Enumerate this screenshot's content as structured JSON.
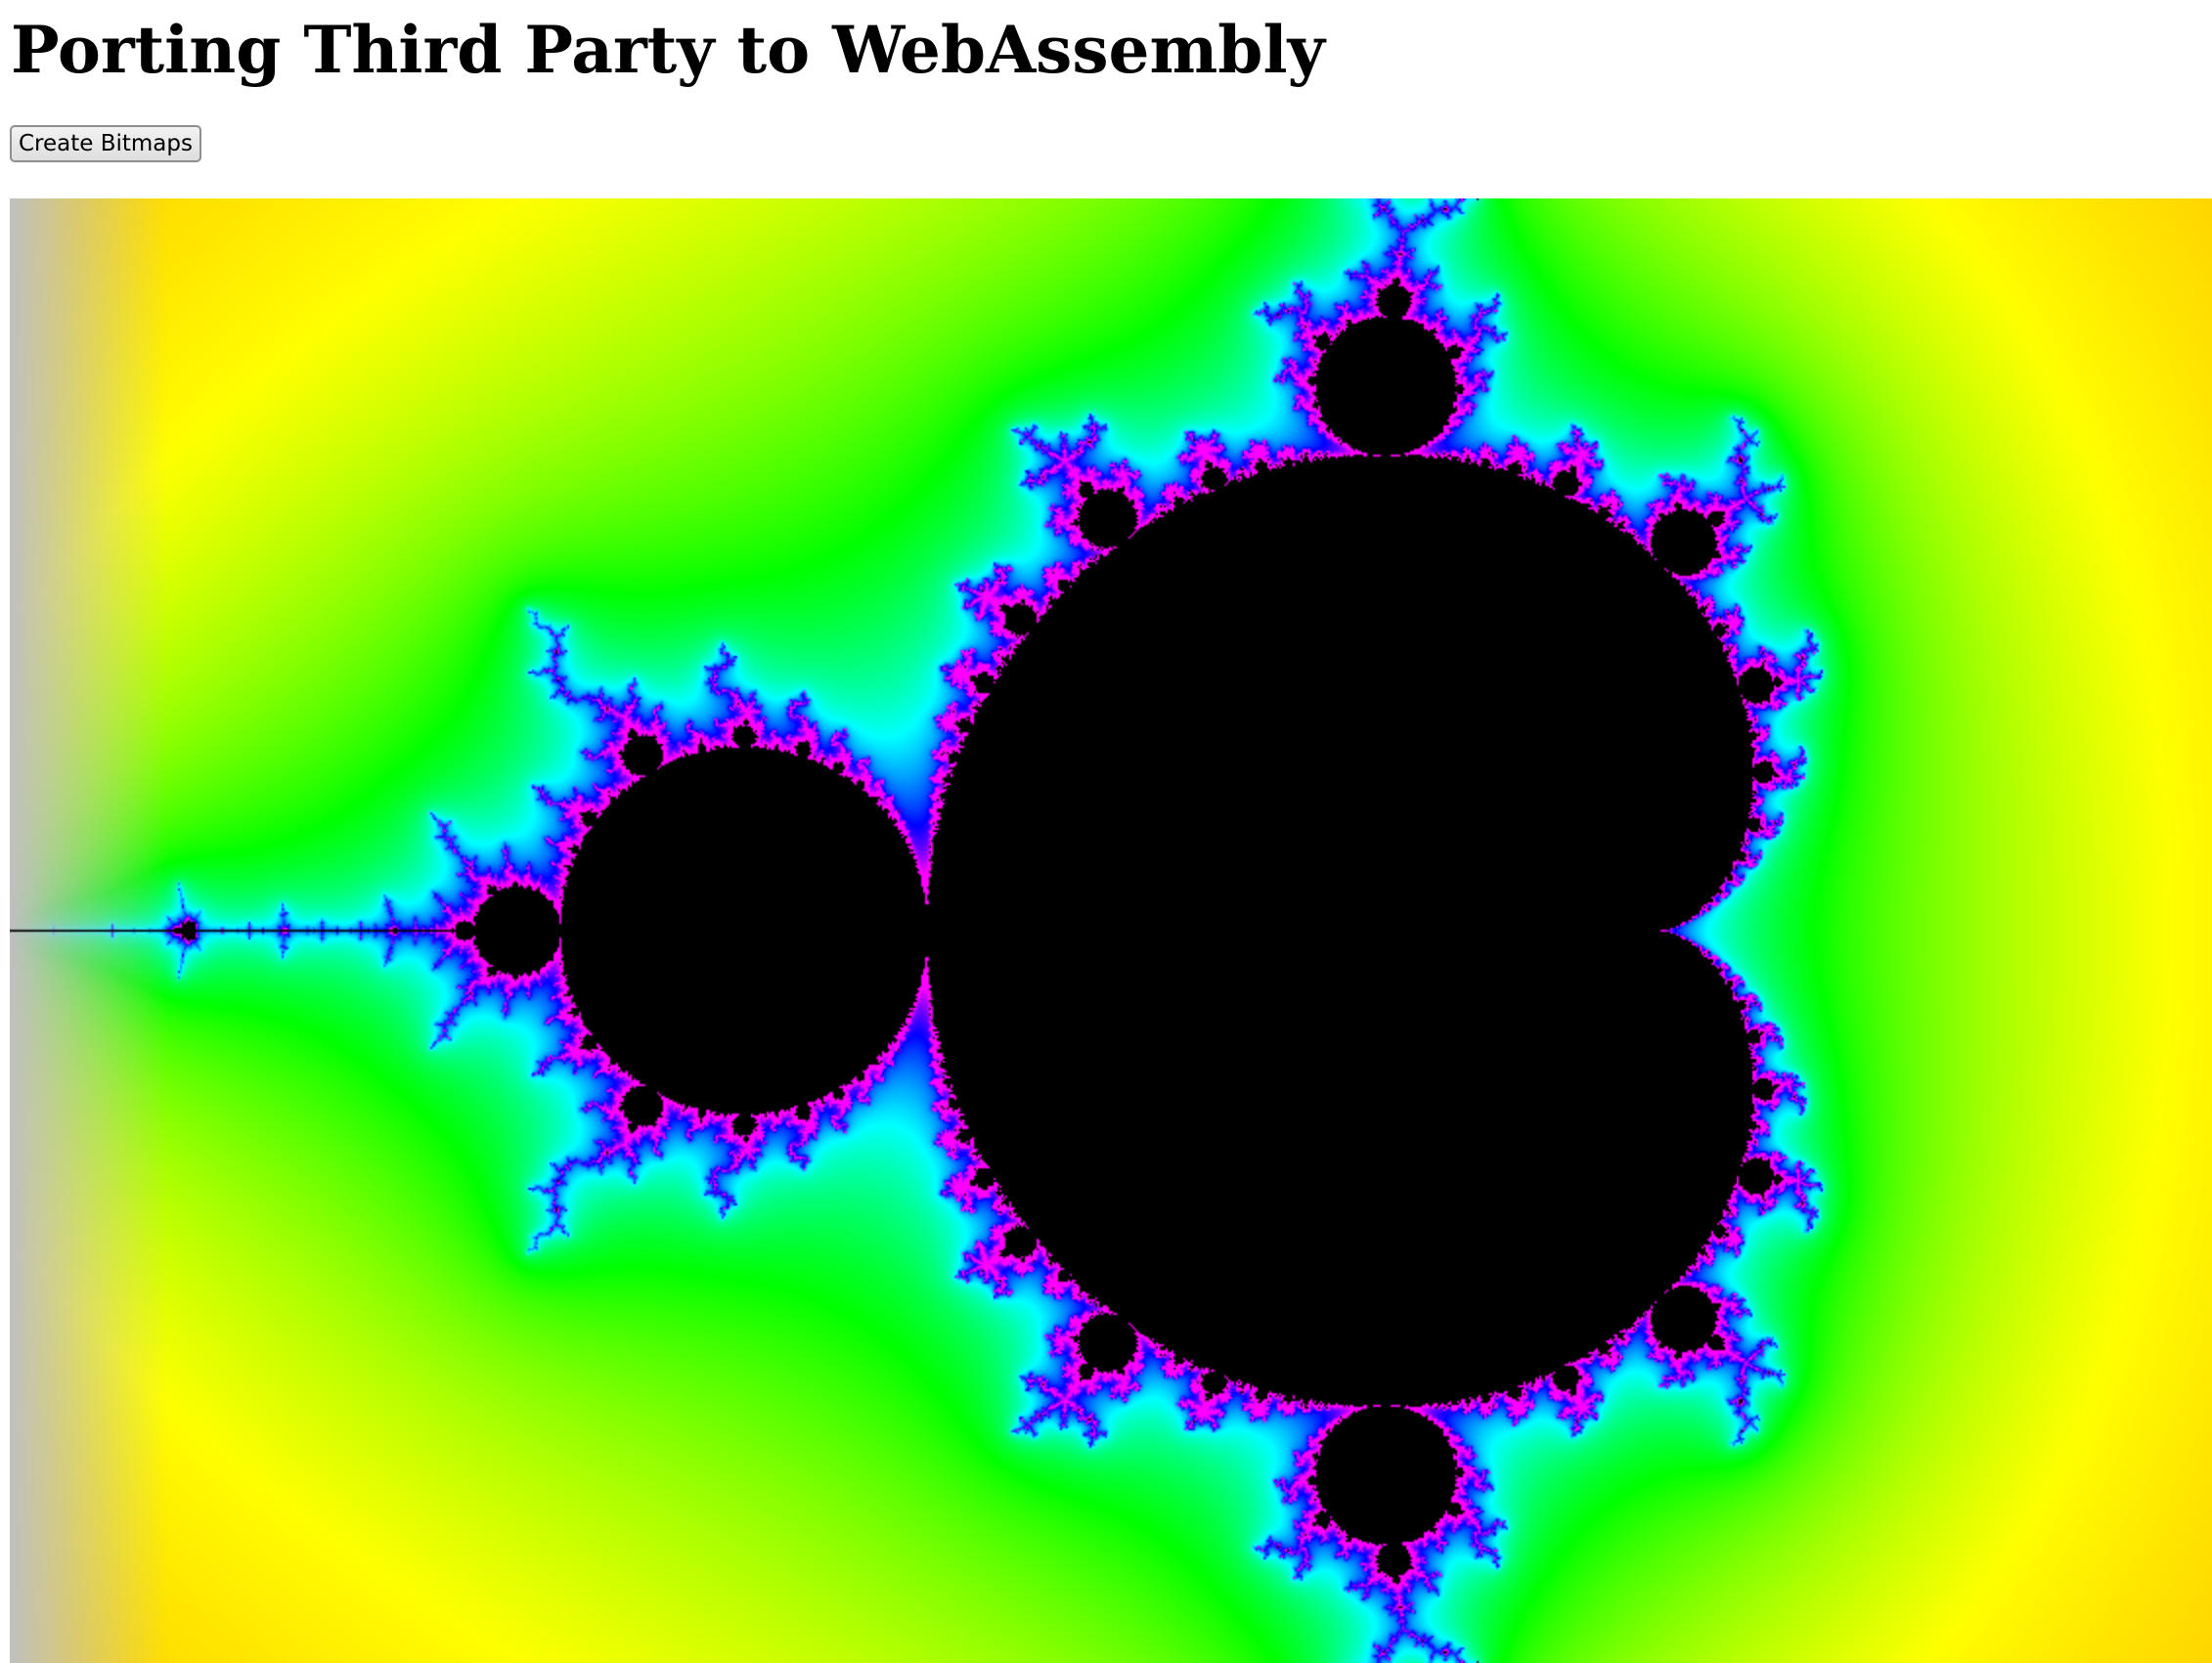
{
  "page": {
    "title": "Porting Third Party to WebAssembly"
  },
  "controls": {
    "create_label": "Create Bitmaps"
  },
  "fractal": {
    "name": "Mandelbrot set",
    "view": {
      "re_min": -2.0,
      "re_max": 1.0,
      "im_min": -1.0,
      "im_max": 1.0
    },
    "max_iterations": 256,
    "inside_color": "#000000",
    "edge_color": "#c0c0c0",
    "palette": [
      "#ff0000",
      "#ff8000",
      "#ffff00",
      "#00ff00",
      "#00ffff",
      "#0000ff",
      "#ff00ff"
    ]
  }
}
